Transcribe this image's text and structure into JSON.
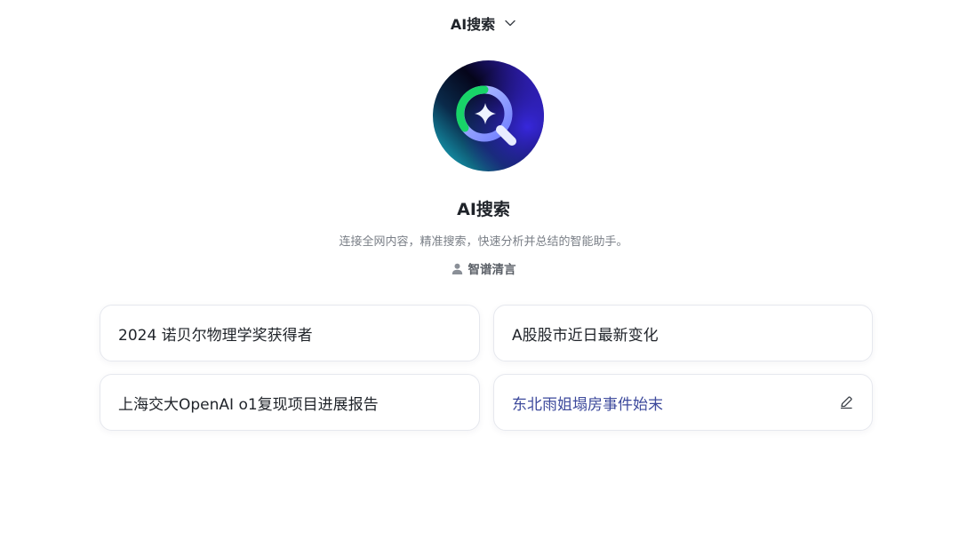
{
  "header": {
    "selector_label": "AI搜索",
    "selector_icon": "chevron-down-icon"
  },
  "agent": {
    "avatar_icon": "ai-search-logo-icon",
    "name": "AI搜索",
    "description": "连接全网内容，精准搜索，快速分析并总结的智能助手。",
    "author_icon": "user-icon",
    "author": "智谱清言"
  },
  "suggestions": [
    {
      "label": "2024 诺贝尔物理学奖获得者"
    },
    {
      "label": "A股股市近日最新变化"
    },
    {
      "label": "上海交大OpenAI o1复现项目进展报告"
    },
    {
      "label": "东北雨姐塌房事件始末",
      "action_icon": "edit-icon"
    }
  ],
  "colors": {
    "text_primary": "#1f2329",
    "text_secondary": "#7a7f87",
    "card_border": "#e6e8ee",
    "hover_text": "#3d4a9c"
  }
}
